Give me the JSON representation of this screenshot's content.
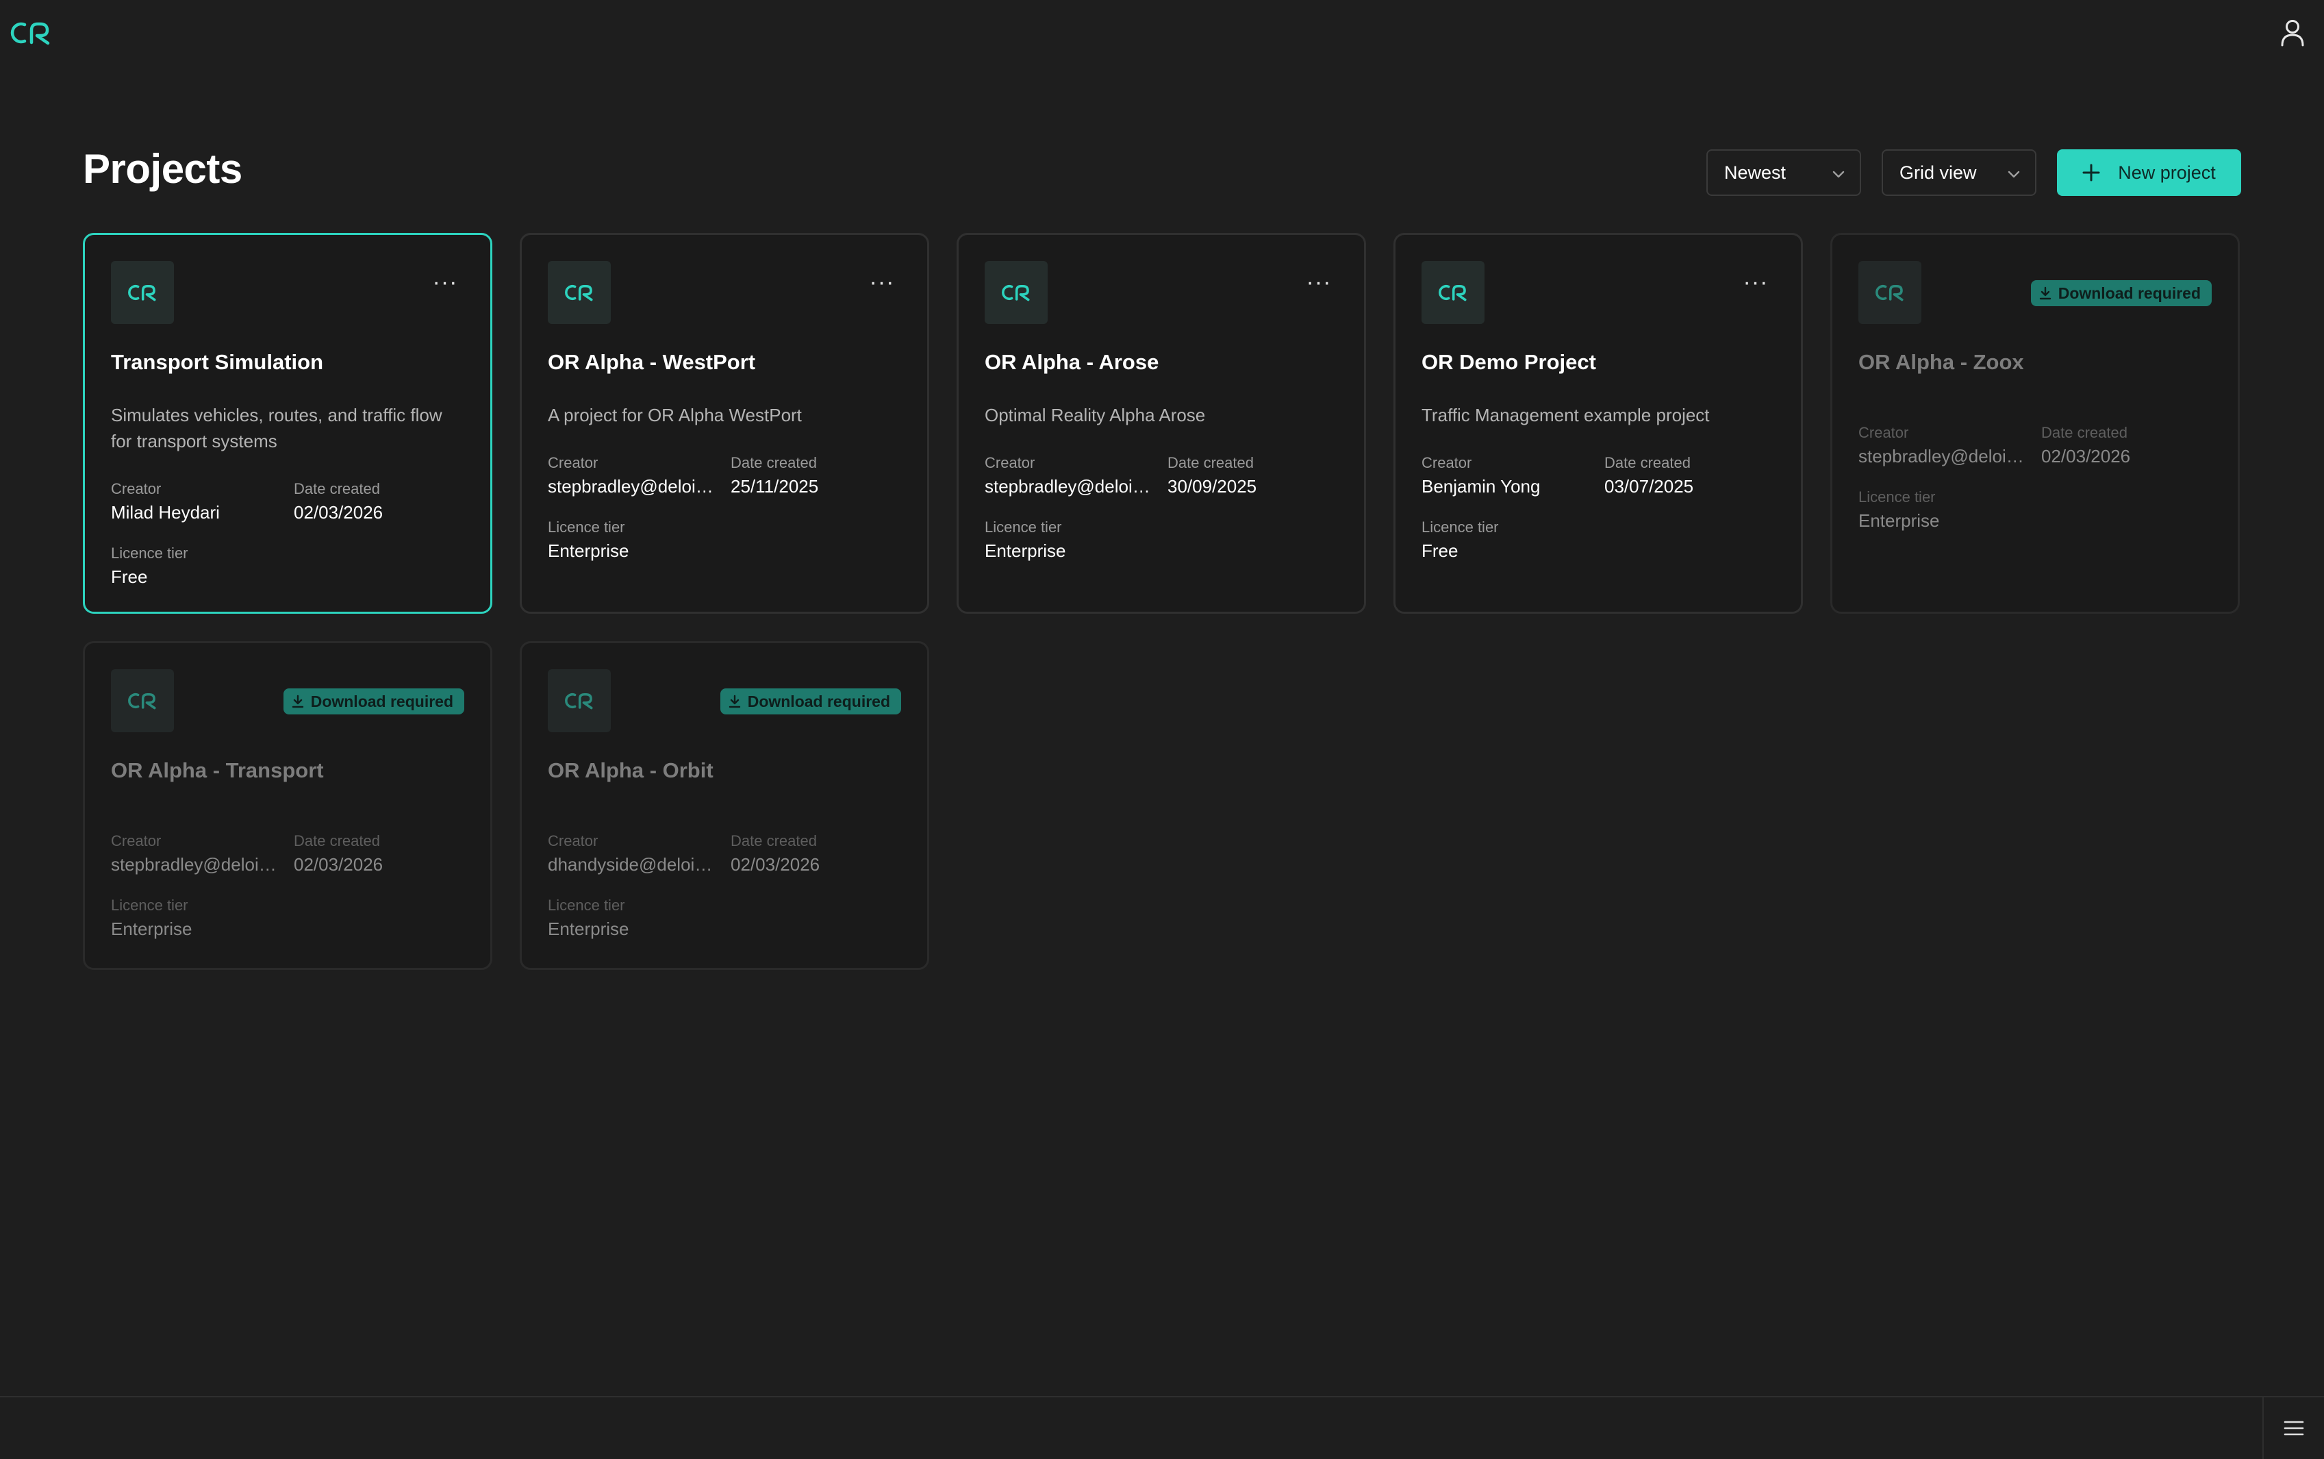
{
  "app": {
    "logo_icon": "or-logo-icon",
    "user_icon": "user-icon",
    "accent_color": "#2dd4bf"
  },
  "header": {
    "title": "Projects",
    "sort_label": "Newest",
    "view_label": "Grid view",
    "new_project_label": "New project"
  },
  "labels": {
    "creator": "Creator",
    "date_created": "Date created",
    "licence_tier": "Licence tier",
    "download_required": "Download required"
  },
  "projects": [
    {
      "title": "Transport Simulation",
      "description": "Simulates vehicles, routes, and traffic flow for transport systems",
      "creator": "Milad Heydari",
      "date_created": "02/03/2026",
      "licence_tier": "Free",
      "state": "selected"
    },
    {
      "title": "OR Alpha - WestPort",
      "description": "A project for OR Alpha WestPort",
      "creator": "stepbradley@deloi…",
      "date_created": "25/11/2025",
      "licence_tier": "Enterprise",
      "state": "normal"
    },
    {
      "title": "OR Alpha - Arose",
      "description": "Optimal Reality Alpha Arose",
      "creator": "stepbradley@deloi…",
      "date_created": "30/09/2025",
      "licence_tier": "Enterprise",
      "state": "normal"
    },
    {
      "title": "OR Demo Project",
      "description": "Traffic Management example project",
      "creator": "Benjamin Yong",
      "date_created": "03/07/2025",
      "licence_tier": "Free",
      "state": "normal"
    },
    {
      "title": "OR Alpha - Zoox",
      "description": "",
      "creator": "stepbradley@deloi…",
      "date_created": "02/03/2026",
      "licence_tier": "Enterprise",
      "state": "download-required"
    },
    {
      "title": "OR Alpha - Transport",
      "description": "",
      "creator": "stepbradley@deloi…",
      "date_created": "02/03/2026",
      "licence_tier": "Enterprise",
      "state": "download-required"
    },
    {
      "title": "OR Alpha - Orbit",
      "description": "",
      "creator": "dhandyside@deloi…",
      "date_created": "02/03/2026",
      "licence_tier": "Enterprise",
      "state": "download-required"
    }
  ],
  "footer": {
    "menu_icon": "hamburger-menu-icon"
  }
}
